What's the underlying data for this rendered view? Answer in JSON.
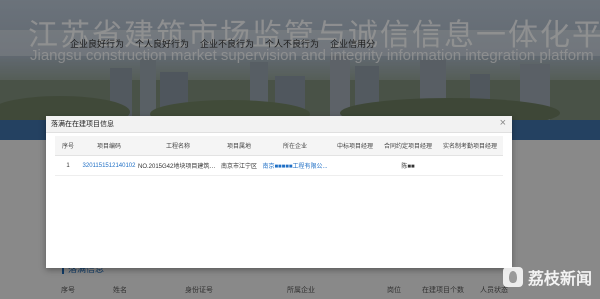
{
  "header": {
    "site_title": "江苏省建筑市场监管与诚信信息一体化平台",
    "site_subtitle": "Jiangsu construction market supervision and integrity information integration platform",
    "nav": [
      "企业良好行为",
      "个人良好行为",
      "企业不良行为",
      "个人不良行为",
      "企业信用分"
    ]
  },
  "modal": {
    "title": "落满在在建项目信息",
    "close_icon": "close-icon",
    "columns": [
      "序号",
      "项目编码",
      "工程名称",
      "项目属地",
      "所在企业",
      "中标项目经理",
      "合同约定项目经理",
      "实名制考勤项目经理"
    ],
    "rows": [
      {
        "index": "1",
        "project_code": "3201151512140102",
        "project_name": "NO.2015G42地块项目建筑安装...",
        "location": "南京市江宁区",
        "company": "南京■■■■■工程有限公...",
        "bid_manager": "",
        "contract_manager": "陈■■",
        "attendance_manager": ""
      }
    ]
  },
  "background_section": {
    "title": "落满信息",
    "columns": [
      "序号",
      "姓名",
      "身份证号",
      "所属企业",
      "岗位",
      "在建项目个数",
      "人员状态"
    ]
  },
  "watermark": {
    "text": "荔枝新闻"
  }
}
